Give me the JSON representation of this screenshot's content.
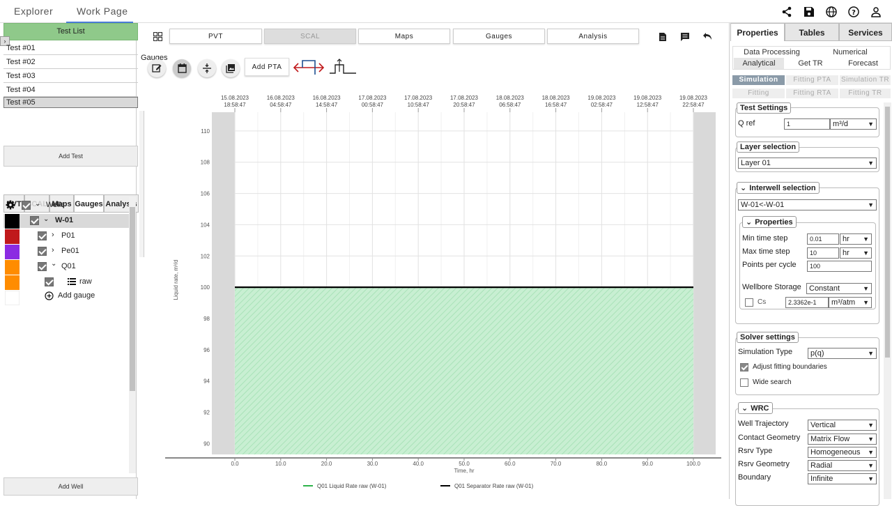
{
  "topbar": {
    "tabs": [
      "Explorer",
      "Work Page"
    ]
  },
  "left": {
    "test_list_title": "Test List",
    "tests": [
      "Test #01",
      "Test #02",
      "Test #03",
      "Test #04",
      "Test #05"
    ],
    "selected_test": "Test #05",
    "add_test": "Add Test",
    "tabs": [
      "PVT",
      "SCAL",
      "Maps",
      "Gauges",
      "Analysis"
    ],
    "active_tab": "Gauges",
    "tree": {
      "wells": "Wells",
      "well": "W-01",
      "gauges": [
        "P01",
        "Pe01",
        "Q01"
      ],
      "raw": "raw",
      "add_gauge": "Add gauge"
    },
    "add_well": "Add Well",
    "swatch_colors": [
      "#000000",
      "#c0191b",
      "#8b2be2",
      "#ff8c00",
      "#ff8c00"
    ]
  },
  "center": {
    "tabs": [
      "PVT",
      "SCAL",
      "Maps",
      "Gauges",
      "Analysis"
    ],
    "disabled_tab": "SCAL",
    "gauges_label": "Gauges",
    "add_pta": "Add PTA"
  },
  "chart_data": {
    "type": "line",
    "top_axis_dates": [
      [
        "15.08.2023",
        "18:58:47"
      ],
      [
        "16.08.2023",
        "04:58:47"
      ],
      [
        "16.08.2023",
        "14:58:47"
      ],
      [
        "17.08.2023",
        "00:58:47"
      ],
      [
        "17.08.2023",
        "10:58:47"
      ],
      [
        "17.08.2023",
        "20:58:47"
      ],
      [
        "18.08.2023",
        "06:58:47"
      ],
      [
        "18.08.2023",
        "16:58:47"
      ],
      [
        "19.08.2023",
        "02:58:47"
      ],
      [
        "19.08.2023",
        "12:58:47"
      ],
      [
        "19.08.2023",
        "22:58:47"
      ]
    ],
    "xlabel": "Time, hr",
    "ylabel": "Liquid rate, m³/d",
    "xticks": [
      "0.0",
      "10.0",
      "20.0",
      "30.0",
      "40.0",
      "50.0",
      "60.0",
      "70.0",
      "80.0",
      "90.0",
      "100.0"
    ],
    "yticks": [
      "90",
      "92",
      "94",
      "96",
      "98",
      "100",
      "102",
      "104",
      "106",
      "108",
      "110"
    ],
    "xlim": [
      0,
      100
    ],
    "ylim": [
      89.3,
      111.2
    ],
    "series": [
      {
        "name": "Q01 Liquid Rate raw (W-01)",
        "color": "#2db34a",
        "x": [
          0,
          100
        ],
        "y": [
          100,
          100
        ],
        "fill": true
      },
      {
        "name": "Q01 Separator Rate raw (W-01)",
        "color": "#000000",
        "x": [
          0,
          100
        ],
        "y": [
          100,
          100
        ],
        "fill": false
      }
    ],
    "grid": true,
    "legend": "bottom"
  },
  "right": {
    "tabs": [
      "Properties",
      "Tables",
      "Services"
    ],
    "active_tab": "Properties",
    "subtabs_row1": [
      "Data Processing",
      "Numerical"
    ],
    "subtabs_row2": [
      "Analytical",
      "Get TR",
      "Forecast"
    ],
    "pills_row1": [
      "Simulation",
      "Fitting PTA",
      "Simulation TR"
    ],
    "pills_row2": [
      "Fitting",
      "Fitting RTA",
      "Fitting TR"
    ],
    "test_settings": {
      "title": "Test Settings",
      "q_ref_label": "Q ref",
      "q_ref_value": "1",
      "q_ref_unit": "m³/d"
    },
    "layer_selection": {
      "title": "Layer selection",
      "value": "Layer 01"
    },
    "interwell": {
      "title": "Interwell selection",
      "value": "W-01<-W-01"
    },
    "properties": {
      "title": "Properties",
      "min_time_step_label": "Min time step",
      "min_time_step": "0.01",
      "min_time_unit": "hr",
      "max_time_step_label": "Max time step",
      "max_time_step": "10",
      "max_time_unit": "hr",
      "points_per_cycle_label": "Points per cycle",
      "points_per_cycle": "100",
      "wellbore_storage_label": "Wellbore Storage",
      "wellbore_storage": "Constant",
      "cs_label": "Cs",
      "cs_value": "2.3362e-1",
      "cs_unit": "m³/atm"
    },
    "solver": {
      "title": "Solver settings",
      "simulation_type_label": "Simulation Type",
      "simulation_type": "p(q)",
      "adjust_label": "Adjust fitting boundaries",
      "wide_label": "Wide search"
    },
    "wrc": {
      "title": "WRC",
      "well_trajectory_label": "Well Trajectory",
      "well_trajectory": "Vertical",
      "contact_geometry_label": "Contact Geometry",
      "contact_geometry": "Matrix Flow",
      "rsrv_type_label": "Rsrv Type",
      "rsrv_type": "Homogeneous",
      "rsrv_geometry_label": "Rsrv Geometry",
      "rsrv_geometry": "Radial",
      "boundary_label": "Boundary",
      "boundary": "Infinite"
    }
  }
}
